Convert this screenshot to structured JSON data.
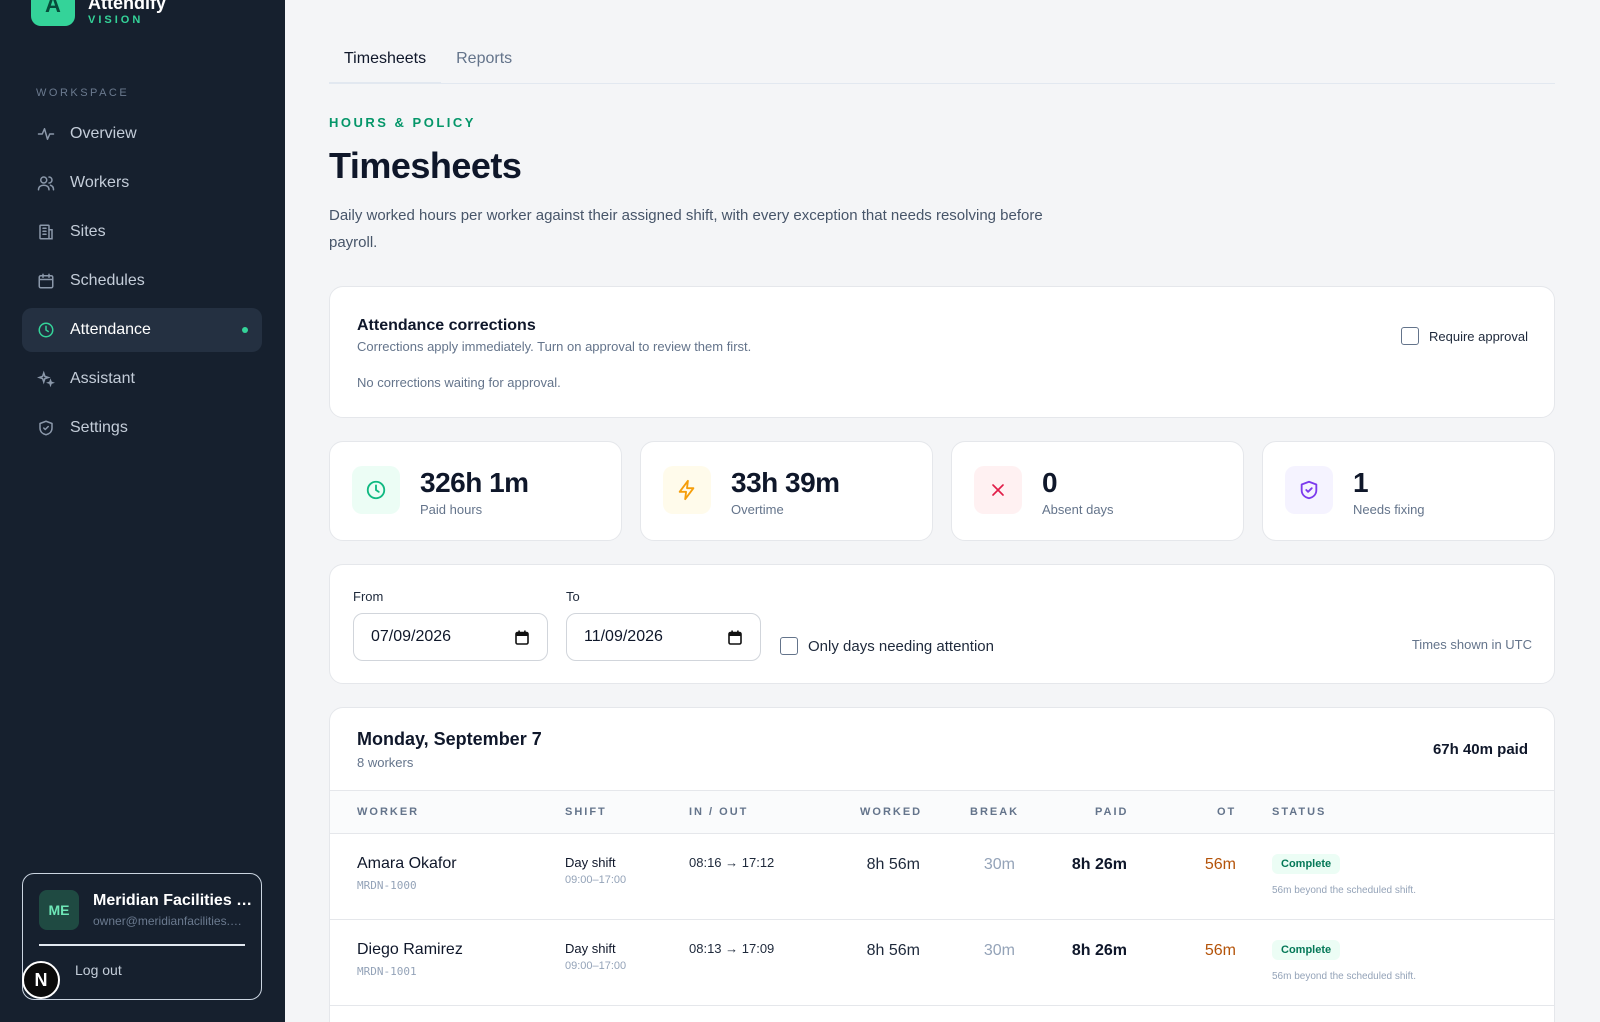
{
  "brand": {
    "logo_letter": "A",
    "name": "Attendify",
    "sub": "VISION",
    "accent": "#34d399"
  },
  "sidebar": {
    "section_label": "WORKSPACE",
    "items": [
      {
        "label": "Overview",
        "icon": "activity-icon"
      },
      {
        "label": "Workers",
        "icon": "users-icon"
      },
      {
        "label": "Sites",
        "icon": "building-icon"
      },
      {
        "label": "Schedules",
        "icon": "calendar-icon"
      },
      {
        "label": "Attendance",
        "icon": "clock-icon",
        "active": true
      },
      {
        "label": "Assistant",
        "icon": "sparkles-icon"
      },
      {
        "label": "Settings",
        "icon": "shield-icon"
      }
    ]
  },
  "user": {
    "initials": "ME",
    "name": "Meridian Facilities Management",
    "email": "owner@meridianfacilities.com",
    "logout_label": "Log out"
  },
  "dev_badge": "N",
  "tabs": [
    {
      "label": "Timesheets",
      "active": true
    },
    {
      "label": "Reports"
    }
  ],
  "header": {
    "eyebrow": "HOURS & POLICY",
    "title": "Timesheets",
    "description": "Daily worked hours per worker against their assigned shift, with every exception that needs resolving before payroll."
  },
  "corrections": {
    "title": "Attendance corrections",
    "subtitle": "Corrections apply immediately. Turn on approval to review them first.",
    "empty": "No corrections waiting for approval.",
    "approval_label": "Require approval",
    "approval_checked": false
  },
  "stats": [
    {
      "value": "326h 1m",
      "label": "Paid hours",
      "icon": "clock-icon",
      "color": "#10b981"
    },
    {
      "value": "33h 39m",
      "label": "Overtime",
      "icon": "lightning-icon",
      "color": "#f59e0b"
    },
    {
      "value": "0",
      "label": "Absent days",
      "icon": "x-icon",
      "color": "#e11d48"
    },
    {
      "value": "1",
      "label": "Needs fixing",
      "icon": "shield-check-icon",
      "color": "#7c3aed"
    }
  ],
  "filters": {
    "from_label": "From",
    "from_value": "07/09/2026",
    "to_label": "To",
    "to_value": "11/09/2026",
    "attention_label": "Only days needing attention",
    "attention_checked": false,
    "timezone_note": "Times shown in UTC"
  },
  "day": {
    "title": "Monday, September 7",
    "count": "8 workers",
    "paid_total": "67h 40m paid",
    "columns": [
      "WORKER",
      "SHIFT",
      "IN / OUT",
      "WORKED",
      "BREAK",
      "PAID",
      "OT",
      "STATUS"
    ],
    "rows": [
      {
        "name": "Amara Okafor",
        "id": "MRDN-1000",
        "shift": "Day shift",
        "shift_time": "09:00–17:00",
        "inout": "08:16 → 17:12",
        "worked": "8h 56m",
        "break": "30m",
        "paid": "8h 26m",
        "ot": "56m",
        "status": "Complete",
        "note": "56m beyond the scheduled shift."
      },
      {
        "name": "Diego Ramirez",
        "id": "MRDN-1001",
        "shift": "Day shift",
        "shift_time": "09:00–17:00",
        "inout": "08:13 → 17:09",
        "worked": "8h 56m",
        "break": "30m",
        "paid": "8h 26m",
        "ot": "56m",
        "status": "Complete",
        "note": "56m beyond the scheduled shift."
      }
    ]
  }
}
